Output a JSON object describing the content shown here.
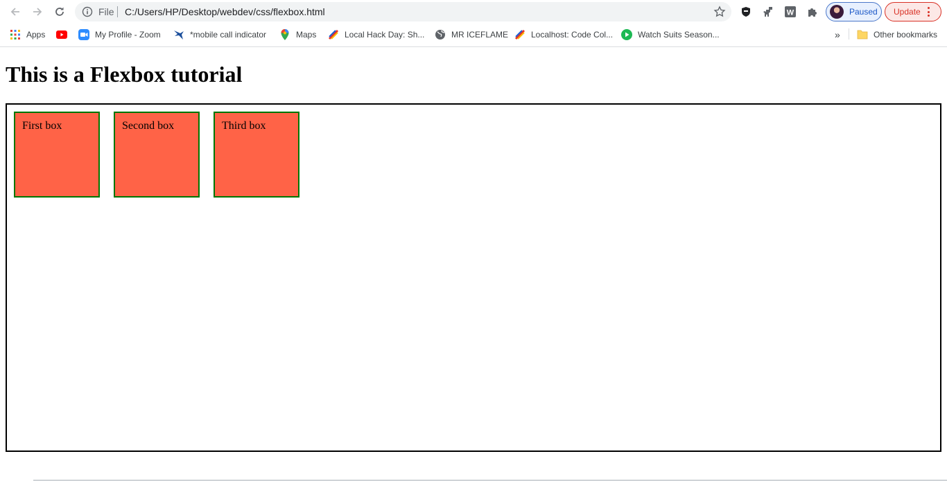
{
  "browser": {
    "nav": {
      "back": "back",
      "forward": "forward",
      "reload": "reload"
    },
    "omnibox": {
      "scheme_label": "File",
      "url": "C:/Users/HP/Desktop/webdev/css/flexbox.html"
    },
    "profile": {
      "label": "Paused"
    },
    "update": {
      "label": "Update"
    },
    "bookmarks": [
      {
        "label": "Apps",
        "icon": "apps-grid-icon"
      },
      {
        "label": "",
        "icon": "youtube-icon"
      },
      {
        "label": "My Profile - Zoom",
        "icon": "zoom-icon"
      },
      {
        "label": "*mobile call indicator",
        "icon": "bird-icon"
      },
      {
        "label": "Maps",
        "icon": "maps-pin-icon"
      },
      {
        "label": "Local Hack Day: Sh...",
        "icon": "mlh-icon"
      },
      {
        "label": "MR ICEFLAME",
        "icon": "globe-icon"
      },
      {
        "label": "Localhost: Code Col...",
        "icon": "mlh-icon"
      },
      {
        "label": "Watch Suits Season...",
        "icon": "play-icon"
      }
    ],
    "overflow_label": "»",
    "other_bookmarks": "Other bookmarks",
    "colors": {
      "accent": "#4a77c9",
      "update": "#d93025"
    }
  },
  "page": {
    "heading": "This is a Flexbox tutorial",
    "boxes": [
      {
        "label": "First box"
      },
      {
        "label": "Second box"
      },
      {
        "label": "Third box"
      }
    ],
    "colors": {
      "box_fill": "#ff6347",
      "box_border": "#007700",
      "container_border": "#000000"
    }
  }
}
